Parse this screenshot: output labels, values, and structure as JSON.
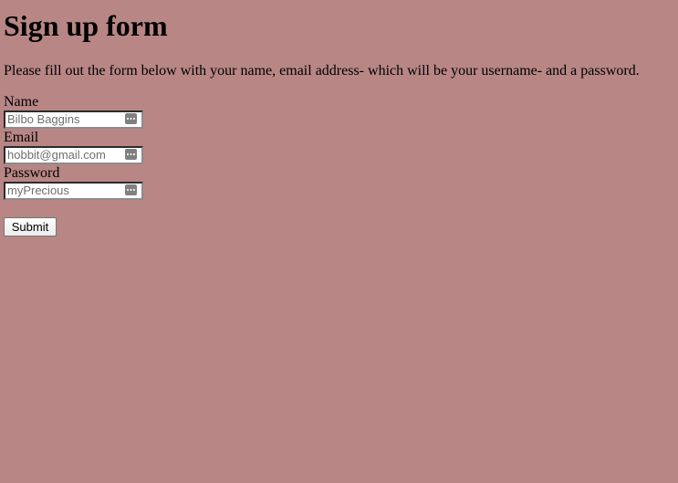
{
  "page": {
    "title": "Sign up form",
    "intro": "Please fill out the form below with your name, email address- which will be your username- and a password."
  },
  "form": {
    "fields": [
      {
        "label": "Name",
        "placeholder": "Bilbo Baggins",
        "value": "",
        "icon": "password-manager-key-icon"
      },
      {
        "label": "Email",
        "placeholder": "hobbit@gmail.com",
        "value": "",
        "icon": "password-manager-key-icon"
      },
      {
        "label": "Password",
        "placeholder": "myPrecious",
        "value": "",
        "icon": "password-manager-key-icon"
      }
    ],
    "submit_label": "Submit"
  },
  "colors": {
    "background": "#b78685",
    "text": "#000000",
    "placeholder": "#6f6f6f",
    "icon": "#808080"
  }
}
